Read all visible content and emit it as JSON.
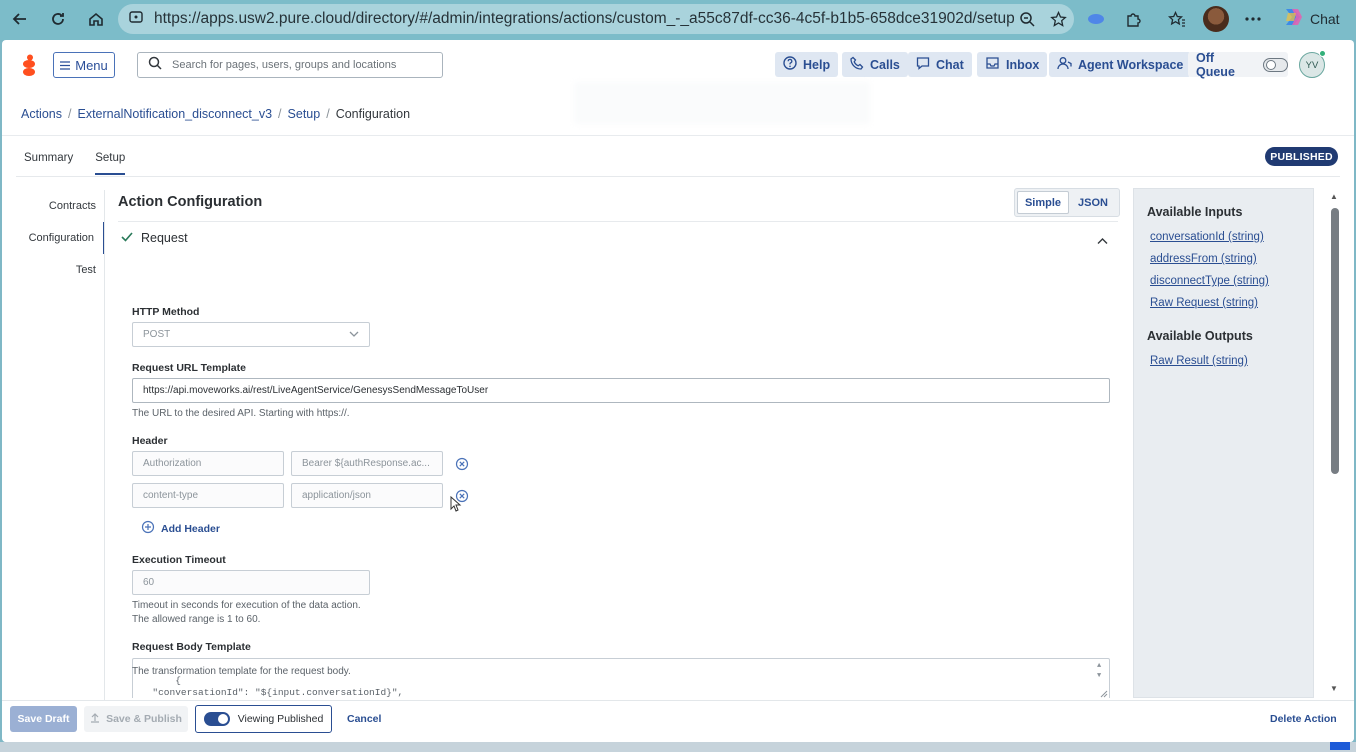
{
  "browser": {
    "url": "https://apps.usw2.pure.cloud/directory/#/admin/integrations/actions/custom_-_a55c87df-cc36-4c5f-b1b5-658dce31902d/setup/...",
    "copilot_label": "Chat",
    "icons": [
      "back-icon",
      "reload-icon",
      "home-icon",
      "site-info-icon",
      "zoom-icon",
      "favorite-star-icon",
      "extension-icon",
      "puzzle-icon",
      "favorites-icon",
      "profile-avatar",
      "more-icon",
      "copilot-icon"
    ]
  },
  "topnav": {
    "menu_label": "Menu",
    "search_placeholder": "Search for pages, users, groups and locations",
    "help": "Help",
    "calls": "Calls",
    "chat": "Chat",
    "inbox": "Inbox",
    "agent_workspace": "Agent Workspace",
    "off_queue": "Off Queue",
    "user_initials": "YV"
  },
  "breadcrumb": {
    "items": [
      "Actions",
      "ExternalNotification_disconnect_v3",
      "Setup"
    ],
    "current": "Configuration"
  },
  "tabs": [
    "Summary",
    "Setup"
  ],
  "status_badge": "PUBLISHED",
  "sidenav": [
    "Contracts",
    "Configuration",
    "Test"
  ],
  "config": {
    "title": "Action Configuration",
    "mode_simple": "Simple",
    "mode_json": "JSON",
    "section": "Request",
    "http_method_label": "HTTP Method",
    "http_method_value": "POST",
    "url_label": "Request URL Template",
    "url_value": "https://api.moveworks.ai/rest/LiveAgentService/GenesysSendMessageToUser",
    "url_help": "The URL to the desired API. Starting with https://.",
    "header_label": "Header",
    "headers": [
      {
        "key": "Authorization",
        "value": "Bearer ${authResponse.ac..."
      },
      {
        "key": "content-type",
        "value": "application/json"
      }
    ],
    "add_header": "Add Header",
    "timeout_label": "Execution Timeout",
    "timeout_value": "60",
    "timeout_help_1": "Timeout in seconds for execution of the data action.",
    "timeout_help_2": "The allowed range is 1 to 60.",
    "body_label": "Request Body Template",
    "body_value": "{\n  \"conversationId\": \"${input.conversationId}\",\n  \"disconnectType\": \"${input.disconnectType}\",",
    "body_help": "The transformation template for the request body."
  },
  "panel": {
    "inputs_title": "Available Inputs",
    "inputs": [
      "conversationId (string)",
      "addressFrom (string)",
      "disconnectType (string)",
      "Raw Request (string)"
    ],
    "outputs_title": "Available Outputs",
    "outputs": [
      "Raw Result (string)"
    ]
  },
  "footer": {
    "save_draft": "Save Draft",
    "save_publish": "Save & Publish",
    "viewing_published": "Viewing Published",
    "cancel": "Cancel",
    "delete_action": "Delete Action"
  },
  "colors": {
    "accent": "#2a4e92",
    "badge": "#203a72",
    "browser_bar": "#7cbcc9"
  }
}
